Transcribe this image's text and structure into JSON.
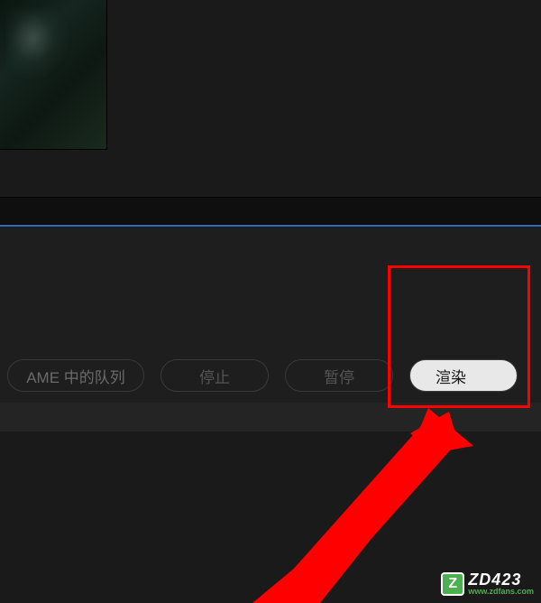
{
  "buttons": {
    "ame_queue": "AME 中的队列",
    "stop": "停止",
    "pause": "暂停",
    "render": "渲染"
  },
  "watermark": {
    "badge": "Z",
    "main": "ZD423",
    "sub": "www.zdfans.com"
  },
  "annotation": {
    "highlight_target": "render-button",
    "color": "#ff0000"
  }
}
